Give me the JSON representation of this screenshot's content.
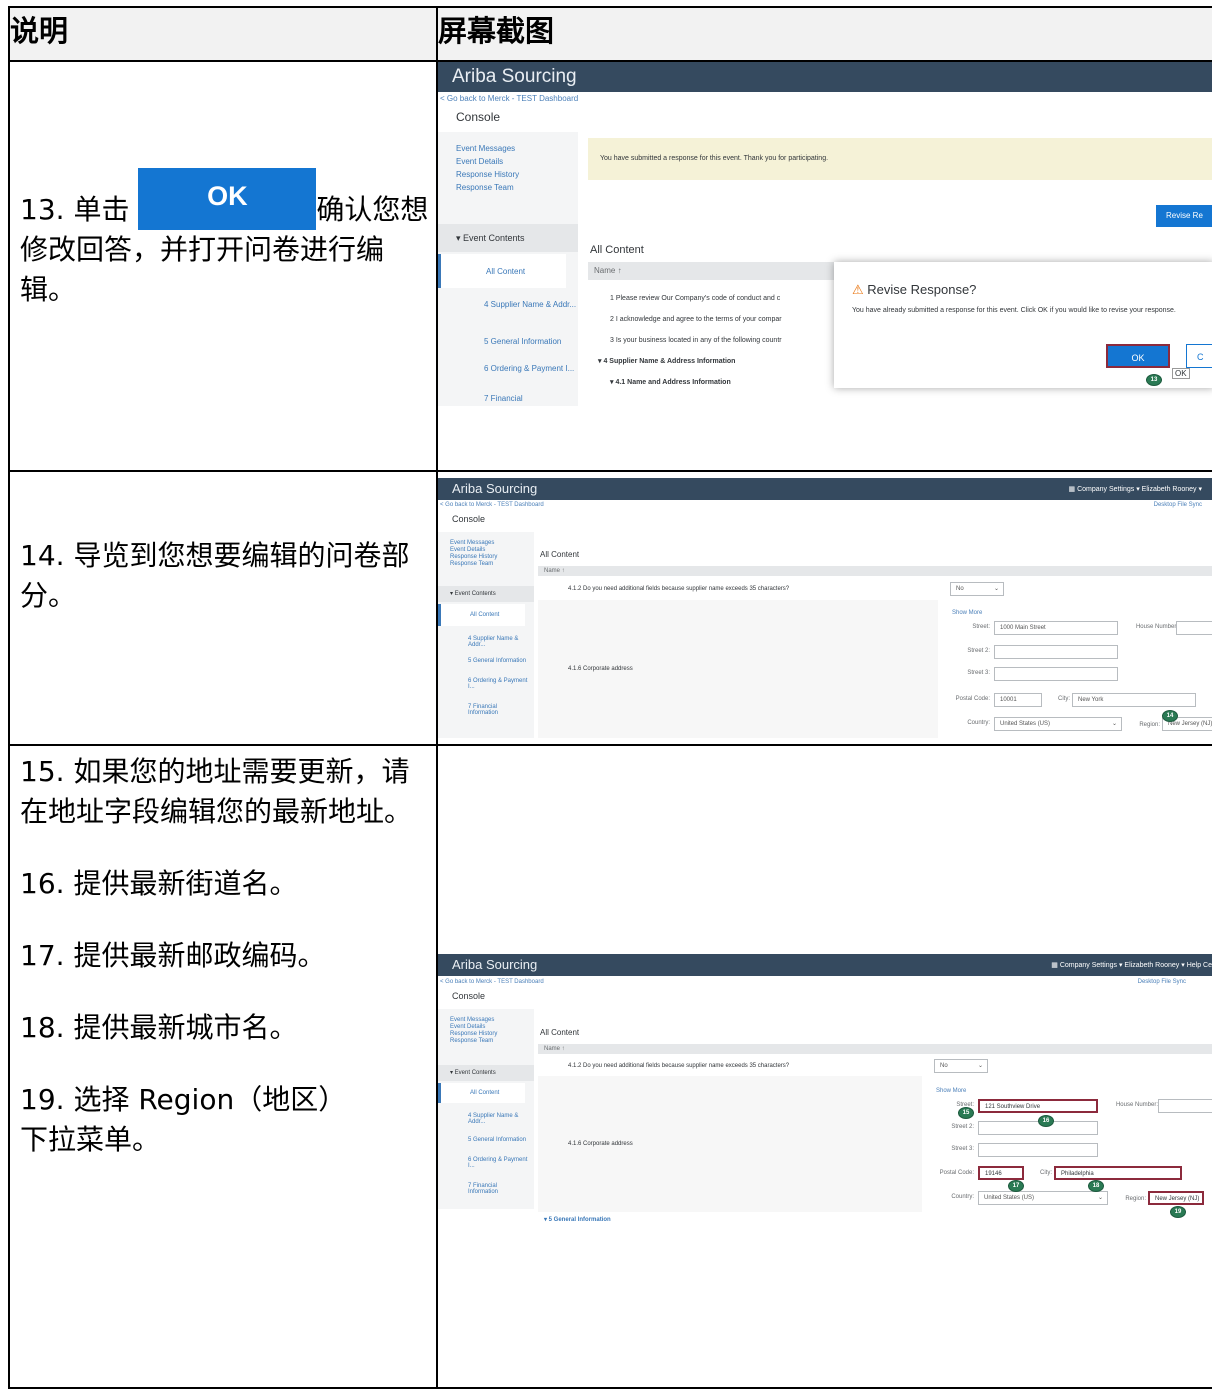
{
  "header": {
    "col1": "说明",
    "col2": "屏幕截图"
  },
  "rows": [
    {
      "step": "13",
      "pre": ". 单击 ",
      "ok_label": "OK",
      "post": "确认您想修改回答，并打开问卷进行编辑。"
    },
    {
      "step": "14",
      "text": ". 导览到您想要编辑的问卷部分。"
    },
    {
      "steps": [
        {
          "num": "15",
          "text": ". 如果您的地址需要更新，请在地址字段编辑您的最新地址。"
        },
        {
          "num": "16",
          "text": ". 提供最新街道名。"
        },
        {
          "num": "17",
          "text": ". 提供最新邮政编码。"
        },
        {
          "num": "18",
          "text": ". 提供最新城市名。"
        },
        {
          "num": "19",
          "text": ". 选择 Region（地区）下拉菜单。"
        }
      ]
    }
  ],
  "shot1": {
    "app_title": "Ariba Sourcing",
    "back_link": "< Go back to Merck - TEST Dashboard",
    "console": "Console",
    "side_links": [
      "Event Messages",
      "Event Details",
      "Response History",
      "Response Team"
    ],
    "event_contents": "▾  Event Contents",
    "side_items": [
      "All Content",
      "4  Supplier Name & Addr...",
      "5  General Information",
      "6  Ordering & Payment I...",
      "7  Financial"
    ],
    "banner": "You have submitted a response for this event. Thank you for participating.",
    "revise_btn": "Revise Re",
    "all_content": "All Content",
    "name_col": "Name ↑",
    "rows": [
      "1  Please review Our Company's code of conduct and c",
      "2  I acknowledge and agree to the terms of your compar",
      "3  Is your business located in any of the following countr",
      "▾ 4  Supplier Name & Address Information",
      "▾ 4.1  Name and Address Information"
    ],
    "dialog_title": "Revise Response?",
    "dialog_text": "You have already submitted a response for this event. Click OK if you would like to revise your response.",
    "dialog_ok": "OK",
    "dialog_cancel": "C",
    "ok_tooltip": "OK",
    "marker": "13"
  },
  "shot2": {
    "app_title": "Ariba Sourcing",
    "menu": "Company Settings ▾    Elizabeth Rooney ▾",
    "back_link": "< Go back to Merck - TEST Dashboard",
    "sync": "Desktop File Sync",
    "console": "Console",
    "side_links": [
      "Event Messages",
      "Event Details",
      "Response History",
      "Response Team"
    ],
    "event_contents": "▾ Event Contents",
    "side_items": [
      "All Content",
      "4  Supplier Name & Addr...",
      "5  General Information",
      "6  Ordering & Payment I...",
      "7  Financial Information"
    ],
    "all_content": "All Content",
    "name_col": "Name ↑",
    "q412": "4.1.2  Do you need additional fields because supplier name exceeds 35 characters?",
    "q412_value": "No",
    "q416": "4.1.6  Corporate address",
    "show_more": "Show More",
    "street_label": "Street:",
    "street_value": "1000 Main Street",
    "house_label": "House Number:",
    "street2_label": "Street 2:",
    "street3_label": "Street 3:",
    "postal_label": "Postal Code:",
    "postal_value": "10001",
    "city_label": "City:",
    "city_value": "New York",
    "country_label": "Country:",
    "country_value": "United States (US)",
    "region_label": "Region:",
    "region_value": "New Jersey (NJ)",
    "marker": "14"
  },
  "shot3": {
    "app_title": "Ariba Sourcing",
    "menu": "Company Settings ▾    Elizabeth Rooney ▾    Help Ce",
    "back_link": "< Go back to Merck - TEST Dashboard",
    "sync": "Desktop File Sync",
    "console": "Console",
    "side_links": [
      "Event Messages",
      "Event Details",
      "Response History",
      "Response Team"
    ],
    "event_contents": "▾ Event Contents",
    "side_items": [
      "All Content",
      "4  Supplier Name & Addr...",
      "5  General Information",
      "6  Ordering & Payment I...",
      "7  Financial Information"
    ],
    "all_content": "All Content",
    "name_col": "Name ↑",
    "q412": "4.1.2  Do you need additional fields because supplier name exceeds 35 characters?",
    "q412_value": "No",
    "q416": "4.1.6  Corporate address",
    "show_more": "Show More",
    "street_label": "Street:",
    "street_value": "121 Southview Drive",
    "house_label": "House Number:",
    "street2_label": "Street 2:",
    "street3_label": "Street 3:",
    "postal_label": "Postal Code:",
    "postal_value": "19146",
    "city_label": "City:",
    "city_value": "Philadelphia",
    "country_label": "Country:",
    "country_value": "United States (US)",
    "region_label": "Region:",
    "region_value": "New Jersey (NJ)",
    "section5": "▾ 5  General Information",
    "markers": [
      "15",
      "16",
      "17",
      "18",
      "19"
    ]
  },
  "colors": {
    "topbar": "#354a5f",
    "ok_blue": "#1476d2",
    "marker_green": "#2a7a54",
    "highlight": "#8c2a3c"
  }
}
